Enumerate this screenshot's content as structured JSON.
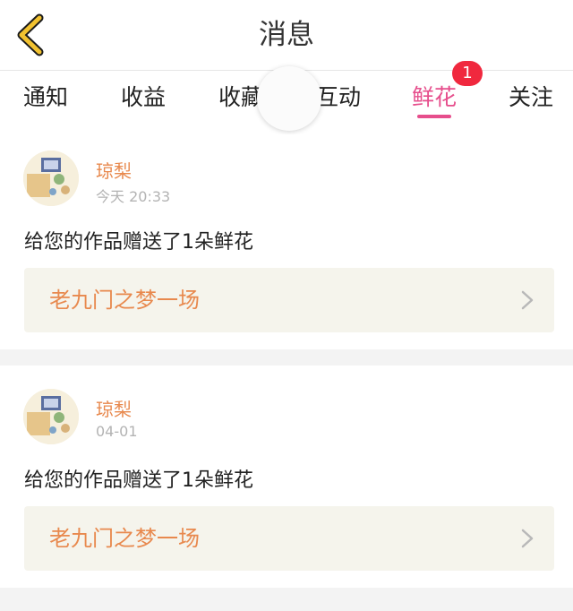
{
  "header": {
    "title": "消息"
  },
  "tabs": [
    {
      "label": "通知"
    },
    {
      "label": "收益"
    },
    {
      "label": "收藏"
    },
    {
      "label": "互动"
    },
    {
      "label": "鲜花",
      "active": true,
      "badge": "1"
    },
    {
      "label": "关注"
    }
  ],
  "messages": [
    {
      "sender": "琼梨",
      "time": "今天 20:33",
      "text": "给您的作品赠送了1朵鲜花",
      "work_title": "老九门之梦一场"
    },
    {
      "sender": "琼梨",
      "time": "04-01",
      "text": "给您的作品赠送了1朵鲜花",
      "work_title": "老九门之梦一场"
    }
  ],
  "colors": {
    "accent_pink": "#e64e8c",
    "name_orange": "#e8894e",
    "badge_red": "#f0283e",
    "back_arrow": "#f2c230"
  },
  "icons": {
    "back": "chevron-left-icon",
    "row_arrow": "chevron-right-icon"
  }
}
